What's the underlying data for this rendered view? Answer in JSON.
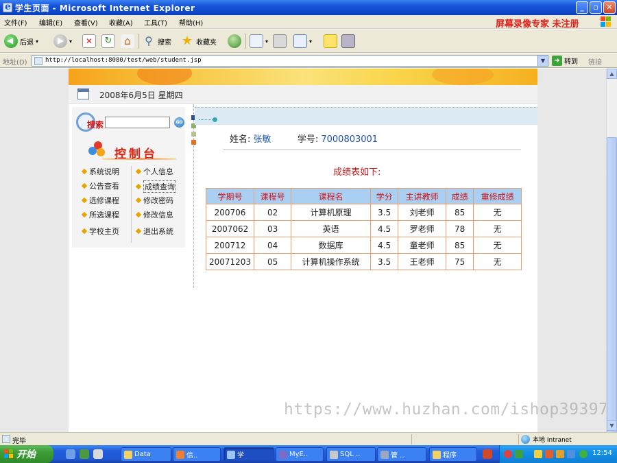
{
  "window": {
    "title": "学生页面 - Microsoft Internet Explorer",
    "watermark_top": "屏幕录像专家 未注册"
  },
  "menu": [
    "文件(F)",
    "编辑(E)",
    "查看(V)",
    "收藏(A)",
    "工具(T)",
    "帮助(H)"
  ],
  "toolbar": {
    "back": "后退",
    "search": "搜索",
    "favorites": "收藏夹"
  },
  "address": {
    "label": "地址(D)",
    "url": "http://localhost:8080/test/web/student.jsp",
    "go": "转到",
    "links": "链接"
  },
  "page": {
    "date": "2008年6月5日  星期四",
    "search_label": "搜索",
    "search_go": "GO",
    "control_panel": "控制台",
    "nav_left": [
      "系统说明",
      "公告查看",
      "选修课程",
      "所选课程",
      "学校主页"
    ],
    "nav_right": [
      "个人信息",
      "成绩查询",
      "修改密码",
      "修改信息",
      "退出系统"
    ],
    "student": {
      "name_label": "姓名:",
      "name": "张敏",
      "id_label": "学号:",
      "id": "7000803001"
    },
    "grade_heading": "成绩表如下:",
    "table": {
      "headers": [
        "学期号",
        "课程号",
        "课程名",
        "学分",
        "主讲教师",
        "成绩",
        "重修成绩"
      ],
      "rows": [
        [
          "200706",
          "02",
          "计算机原理",
          "3.5",
          "刘老师",
          "85",
          "无"
        ],
        [
          "2007062",
          "03",
          "英语",
          "4.5",
          "罗老师",
          "78",
          "无"
        ],
        [
          "200712",
          "04",
          "数据库",
          "4.5",
          "童老师",
          "85",
          "无"
        ],
        [
          "20071203",
          "05",
          "计算机操作系统",
          "3.5",
          "王老师",
          "75",
          "无"
        ]
      ]
    }
  },
  "watermark_url": "https://www.huzhan.com/ishop39397",
  "status": {
    "text": "完毕",
    "zone": "本地 Intranet"
  },
  "taskbar": {
    "start": "开始",
    "tasks": [
      "Data",
      "信..",
      "学",
      "MyE..",
      "SQL ..",
      "管 ..",
      "程序"
    ],
    "clock": "12:54"
  },
  "colors": {
    "accent_red": "#d01515",
    "table_header_bg": "#a9cff3",
    "table_border": "#e2a070",
    "link_blue": "#1f53a8"
  }
}
